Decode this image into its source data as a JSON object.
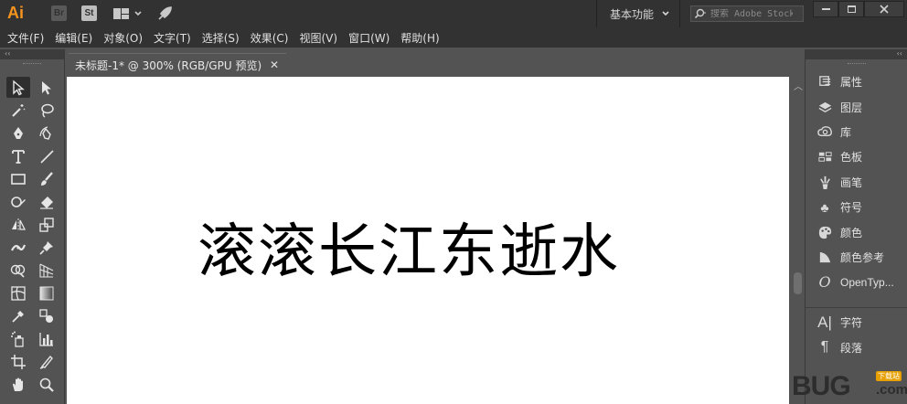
{
  "app": {
    "logo": "Ai",
    "bridge_label": "Br",
    "stock_label": "St",
    "workspace": "基本功能",
    "search_placeholder": "搜索 Adobe Stock"
  },
  "menu": [
    "文件(F)",
    "编辑(E)",
    "对象(O)",
    "文字(T)",
    "选择(S)",
    "效果(C)",
    "视图(V)",
    "窗口(W)",
    "帮助(H)"
  ],
  "document": {
    "tab_title": "未标题-1* @ 300% (RGB/GPU 预览)",
    "canvas_text": "滚滚长江东逝水"
  },
  "panels": {
    "group1": [
      "属性",
      "图层",
      "库",
      "色板",
      "画笔",
      "符号",
      "颜色",
      "颜色参考",
      "OpenTyp..."
    ],
    "group2": [
      "字符",
      "段落"
    ]
  },
  "watermark": {
    "text": "BUG",
    "badge": "下载站",
    "suffix": ".com"
  },
  "colors": {
    "ai_logo": "#f7941d",
    "app_chrome": "#323232",
    "panel_bg": "#535353",
    "canvas": "#ffffff"
  }
}
